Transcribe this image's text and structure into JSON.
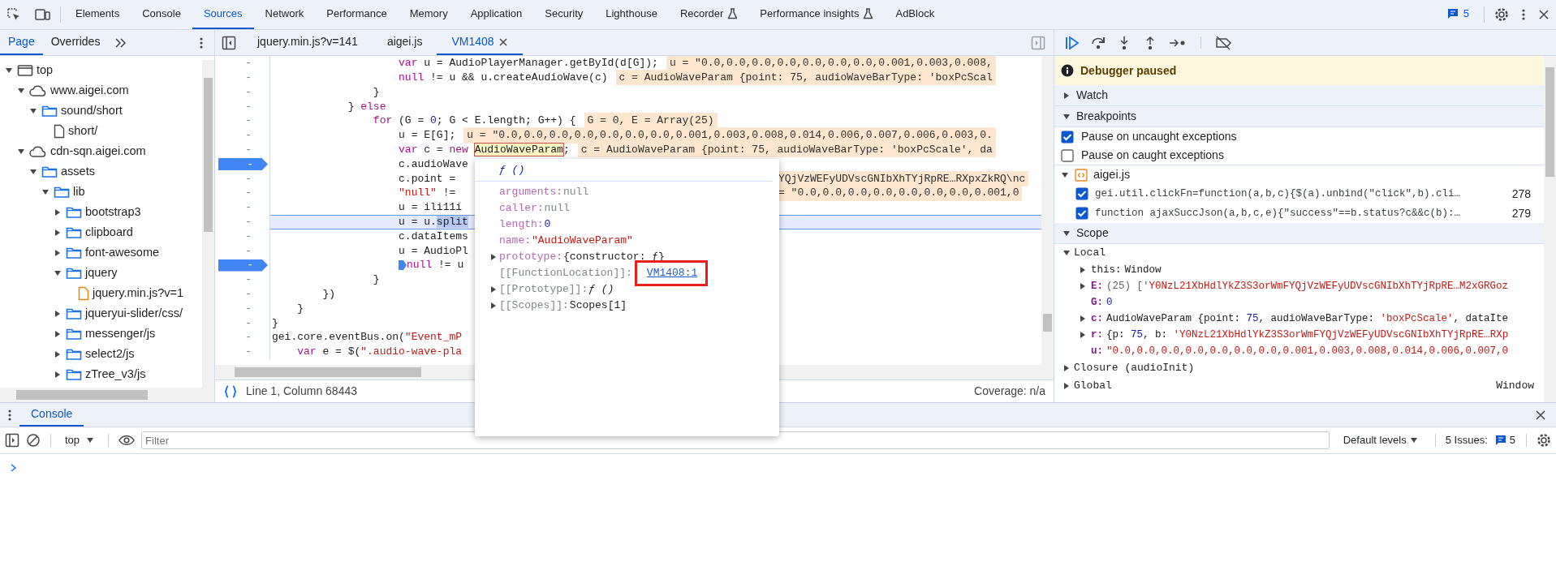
{
  "main_toolbar": {
    "tabs": [
      {
        "label": "Elements",
        "selected": false,
        "experimental": false
      },
      {
        "label": "Console",
        "selected": false,
        "experimental": false
      },
      {
        "label": "Sources",
        "selected": true,
        "experimental": false
      },
      {
        "label": "Network",
        "selected": false,
        "experimental": false
      },
      {
        "label": "Performance",
        "selected": false,
        "experimental": false
      },
      {
        "label": "Memory",
        "selected": false,
        "experimental": false
      },
      {
        "label": "Application",
        "selected": false,
        "experimental": false
      },
      {
        "label": "Security",
        "selected": false,
        "experimental": false
      },
      {
        "label": "Lighthouse",
        "selected": false,
        "experimental": false
      },
      {
        "label": "Recorder",
        "selected": false,
        "experimental": true
      },
      {
        "label": "Performance insights",
        "selected": false,
        "experimental": true
      },
      {
        "label": "AdBlock",
        "selected": false,
        "experimental": false
      }
    ],
    "issues_count": "5"
  },
  "navigator": {
    "tabs": [
      {
        "label": "Page",
        "selected": true
      },
      {
        "label": "Overrides",
        "selected": false
      }
    ],
    "tree": [
      {
        "label": "top",
        "kind": "frame",
        "expanded": true,
        "children": [
          {
            "label": "www.aigei.com",
            "kind": "domain",
            "expanded": true,
            "children": [
              {
                "label": "sound/short",
                "kind": "folder",
                "expanded": true,
                "children": [
                  {
                    "label": "short/",
                    "kind": "document"
                  }
                ]
              }
            ]
          },
          {
            "label": "cdn-sqn.aigei.com",
            "kind": "domain",
            "expanded": true,
            "children": [
              {
                "label": "assets",
                "kind": "folder",
                "expanded": true,
                "children": [
                  {
                    "label": "lib",
                    "kind": "folder",
                    "expanded": true,
                    "children": [
                      {
                        "label": "bootstrap3",
                        "kind": "folder",
                        "expanded": false
                      },
                      {
                        "label": "clipboard",
                        "kind": "folder",
                        "expanded": false
                      },
                      {
                        "label": "font-awesome",
                        "kind": "folder",
                        "expanded": false
                      },
                      {
                        "label": "jquery",
                        "kind": "folder",
                        "expanded": true,
                        "children": [
                          {
                            "label": "jquery.min.js?v=1",
                            "kind": "script"
                          }
                        ]
                      },
                      {
                        "label": "jqueryui-slider/css/",
                        "kind": "folder",
                        "expanded": false
                      },
                      {
                        "label": "messenger/js",
                        "kind": "folder",
                        "expanded": false
                      },
                      {
                        "label": "select2/js",
                        "kind": "folder",
                        "expanded": false
                      },
                      {
                        "label": "zTree_v3/js",
                        "kind": "folder",
                        "expanded": false
                      }
                    ]
                  }
                ]
              }
            ]
          }
        ]
      }
    ]
  },
  "editor": {
    "tabs": [
      {
        "label": "jquery.min.js?v=141",
        "selected": false
      },
      {
        "label": "aigei.js",
        "selected": false
      },
      {
        "label": "VM1408",
        "selected": true
      }
    ],
    "lines": [
      {
        "gutter": "-",
        "breakpoint": false,
        "current": false,
        "paused_at": false,
        "tokens": [
          {
            "text": "                    var",
            "kind": "keyword"
          },
          {
            "text": " u = AudioPlayerManager.getById(d[G]);",
            "kind": "plain"
          }
        ],
        "inline": "u = \"0.0,0.0,0.0,0.0,0.0,0.0,0.0,0.001,0.003,0.008,"
      },
      {
        "gutter": "-",
        "breakpoint": false,
        "current": false,
        "paused_at": false,
        "tokens": [
          {
            "text": "                    null",
            "kind": "keyword"
          },
          {
            "text": " != u && u.createAudioWave(c)",
            "kind": "plain"
          }
        ],
        "inline": "c = AudioWaveParam {point: 75, audioWaveBarType: 'boxPcScal"
      },
      {
        "gutter": "-",
        "breakpoint": false,
        "current": false,
        "paused_at": false,
        "tokens": [
          {
            "text": "                }",
            "kind": "plain"
          }
        ]
      },
      {
        "gutter": "-",
        "breakpoint": false,
        "current": false,
        "paused_at": false,
        "tokens": [
          {
            "text": "            } ",
            "kind": "plain"
          },
          {
            "text": "else",
            "kind": "keyword"
          }
        ]
      },
      {
        "gutter": "-",
        "breakpoint": false,
        "current": false,
        "paused_at": false,
        "tokens": [
          {
            "text": "                for",
            "kind": "keyword"
          },
          {
            "text": " (G = ",
            "kind": "plain"
          },
          {
            "text": "0",
            "kind": "number"
          },
          {
            "text": "; G < E.length; G++) {",
            "kind": "plain"
          }
        ],
        "inline": "G = 0, E = Array(25)"
      },
      {
        "gutter": "-",
        "breakpoint": false,
        "current": false,
        "paused_at": false,
        "tokens": [
          {
            "text": "                    u = E[G];",
            "kind": "plain"
          }
        ],
        "inline": "u = \"0.0,0.0,0.0,0.0,0.0,0.0,0.0,0.001,0.003,0.008,0.014,0.006,0.007,0.006,0.003,0."
      },
      {
        "gutter": "-",
        "breakpoint": false,
        "current": false,
        "paused_at": false,
        "tokens": [
          {
            "text": "                    var",
            "kind": "keyword"
          },
          {
            "text": " c = ",
            "kind": "plain"
          },
          {
            "text": "new ",
            "kind": "keyword"
          },
          {
            "text": "AudioWaveParam",
            "kind": "hovered"
          },
          {
            "text": ";",
            "kind": "plain"
          }
        ],
        "inline": "c = AudioWaveParam {point: 75, audioWaveBarType: 'boxPcScale', da"
      },
      {
        "gutter": "-",
        "breakpoint": true,
        "current": false,
        "paused_at": false,
        "tokens": [
          {
            "text": "                    c.audioWave",
            "kind": "plain"
          }
        ]
      },
      {
        "gutter": "-",
        "breakpoint": false,
        "current": false,
        "paused_at": false,
        "tokens": [
          {
            "text": "                    c.point =",
            "kind": "plain"
          }
        ],
        "inline_past_popover": "YQjVzWEFyUDVscGNIbXhTYjRpRE…RXpxZkRQ\\nc"
      },
      {
        "gutter": "-",
        "breakpoint": false,
        "current": false,
        "paused_at": false,
        "tokens": [
          {
            "text": "                    \"null\"",
            "kind": "string"
          },
          {
            "text": " !=",
            "kind": "plain"
          }
        ],
        "inline_past_popover": "= \"0.0,0.0,0.0,0.0,0.0,0.0,0.0,0.001,0"
      },
      {
        "gutter": "-",
        "breakpoint": false,
        "current": false,
        "paused_at": false,
        "tokens": [
          {
            "text": "                    u = ili11i",
            "kind": "plain"
          }
        ]
      },
      {
        "gutter": "-",
        "breakpoint": false,
        "current": true,
        "paused_at": false,
        "tokens": [
          {
            "text": "                    u = u.",
            "kind": "plain"
          },
          {
            "text": "split",
            "kind": "selected"
          }
        ]
      },
      {
        "gutter": "-",
        "breakpoint": false,
        "current": false,
        "paused_at": false,
        "tokens": [
          {
            "text": "                    c.dataItems",
            "kind": "plain"
          }
        ]
      },
      {
        "gutter": "-",
        "breakpoint": false,
        "current": false,
        "paused_at": false,
        "tokens": [
          {
            "text": "                    u = AudioPl",
            "kind": "plain"
          }
        ]
      },
      {
        "gutter": "-",
        "breakpoint": true,
        "current": false,
        "paused_at": true,
        "tokens": [
          {
            "text": "                    null",
            "kind": "keyword"
          },
          {
            "text": " != u",
            "kind": "plain"
          }
        ]
      },
      {
        "gutter": "-",
        "breakpoint": false,
        "current": false,
        "paused_at": false,
        "tokens": [
          {
            "text": "                }",
            "kind": "plain"
          }
        ]
      },
      {
        "gutter": "-",
        "breakpoint": false,
        "current": false,
        "paused_at": false,
        "tokens": [
          {
            "text": "        })",
            "kind": "plain"
          }
        ]
      },
      {
        "gutter": "-",
        "breakpoint": false,
        "current": false,
        "paused_at": false,
        "tokens": [
          {
            "text": "    }",
            "kind": "plain"
          }
        ]
      },
      {
        "gutter": "-",
        "breakpoint": false,
        "current": false,
        "paused_at": false,
        "tokens": [
          {
            "text": "}",
            "kind": "plain"
          }
        ]
      },
      {
        "gutter": "-",
        "breakpoint": false,
        "current": false,
        "paused_at": false,
        "tokens": [
          {
            "text": "gei.core.eventBus.on(",
            "kind": "plain"
          },
          {
            "text": "\"Event_mP",
            "kind": "string"
          }
        ]
      },
      {
        "gutter": "-",
        "breakpoint": false,
        "current": false,
        "paused_at": false,
        "tokens": [
          {
            "text": "    var",
            "kind": "keyword"
          },
          {
            "text": " e = $(",
            "kind": "plain"
          },
          {
            "text": "\".audio-wave-pla",
            "kind": "string"
          }
        ]
      }
    ],
    "status": {
      "position": "Line 1, Column 68443",
      "coverage": "Coverage: n/a"
    }
  },
  "popover": {
    "title": "ƒ ()",
    "props": [
      {
        "key": "arguments:",
        "internal": false,
        "expandable": false,
        "annotated": false,
        "value": {
          "text": "null",
          "kind": "null"
        }
      },
      {
        "key": "caller:",
        "internal": false,
        "expandable": false,
        "annotated": false,
        "value": {
          "text": "null",
          "kind": "null"
        }
      },
      {
        "key": "length:",
        "internal": false,
        "expandable": false,
        "annotated": false,
        "value": {
          "text": "0",
          "kind": "number"
        }
      },
      {
        "key": "name:",
        "internal": false,
        "expandable": false,
        "annotated": false,
        "value": {
          "text": "\"AudioWaveParam\"",
          "kind": "string"
        }
      },
      {
        "key": "prototype:",
        "internal": false,
        "expandable": true,
        "annotated": false,
        "value": {
          "text": "{constructor: ƒ}",
          "kind": "plain"
        }
      },
      {
        "key": "[[FunctionLocation]]:",
        "internal": true,
        "expandable": false,
        "annotated": true,
        "value": {
          "text": "VM1408:1",
          "kind": "link"
        }
      },
      {
        "key": "[[Prototype]]:",
        "internal": true,
        "expandable": true,
        "annotated": false,
        "value": {
          "text": "ƒ ()",
          "kind": "function"
        }
      },
      {
        "key": "[[Scopes]]:",
        "internal": true,
        "expandable": true,
        "annotated": false,
        "value": {
          "text": "Scopes[1]",
          "kind": "plain"
        }
      }
    ]
  },
  "debugger": {
    "banner": "Debugger paused",
    "watch": {
      "label": "Watch",
      "expanded": false
    },
    "breakpoints": {
      "label": "Breakpoints",
      "expanded": true,
      "options": [
        {
          "label": "Pause on uncaught exceptions",
          "checked": true
        },
        {
          "label": "Pause on caught exceptions",
          "checked": false
        }
      ],
      "files": [
        {
          "name": "aigei.js",
          "expanded": true,
          "items": [
            {
              "code": "gei.util.clickFn=function(a,b,c){$(a).unbind(\"click\",b).cli…",
              "line": "278",
              "checked": true
            },
            {
              "code": "function ajaxSuccJson(a,b,c,e){\"success\"==b.status?c&&c(b):…",
              "line": "279",
              "checked": true
            }
          ]
        }
      ]
    },
    "scope": {
      "label": "Scope",
      "expanded": true,
      "groups": [
        {
          "label": "Local",
          "expanded": true,
          "entries": [
            {
              "key": "this:",
              "emphasized": false,
              "expandable": true,
              "value": [
                {
                  "text": "Window",
                  "kind": "plain"
                }
              ]
            },
            {
              "key": "E:",
              "emphasized": true,
              "expandable": true,
              "value": [
                {
                  "text": "(25) ['",
                  "kind": "dim"
                },
                {
                  "text": "Y0NzL21XbHdlYkZ3S3orWmFYQjVzWEFyUDVscGNIbXhTYjRpRE…M2xGRGoz",
                  "kind": "string"
                }
              ]
            },
            {
              "key": "G:",
              "emphasized": true,
              "expandable": false,
              "value": [
                {
                  "text": "0",
                  "kind": "number"
                }
              ]
            },
            {
              "key": "c:",
              "emphasized": true,
              "expandable": true,
              "value": [
                {
                  "text": "AudioWaveParam {point: ",
                  "kind": "plain"
                },
                {
                  "text": "75",
                  "kind": "number"
                },
                {
                  "text": ", audioWaveBarType: ",
                  "kind": "plain"
                },
                {
                  "text": "'boxPcScale'",
                  "kind": "string"
                },
                {
                  "text": ", dataIte",
                  "kind": "plain"
                }
              ]
            },
            {
              "key": "r:",
              "emphasized": true,
              "expandable": true,
              "value": [
                {
                  "text": "{p: ",
                  "kind": "plain"
                },
                {
                  "text": "75",
                  "kind": "number"
                },
                {
                  "text": ", b: ",
                  "kind": "plain"
                },
                {
                  "text": "'Y0NzL21XbHdlYkZ3S3orWmFYQjVzWEFyUDVscGNIbXhTYjRpRE…RXp",
                  "kind": "string"
                }
              ]
            },
            {
              "key": "u:",
              "emphasized": true,
              "expandable": false,
              "value": [
                {
                  "text": "\"0.0,0.0,0.0,0.0,0.0,0.0,0.0,0.001,0.003,0.008,0.014,0.006,0.007,0",
                  "kind": "string"
                }
              ]
            }
          ]
        },
        {
          "label": "Closure (audioInit)",
          "expanded": false
        },
        {
          "label": "Global",
          "expanded": false,
          "value": "Window"
        }
      ]
    }
  },
  "drawer": {
    "tabs": [
      {
        "label": "Console",
        "selected": true
      }
    ],
    "context": "top",
    "filter_placeholder": "Filter",
    "levels": "Default levels",
    "issues_label": "5 Issues:",
    "issues_count": "5"
  }
}
